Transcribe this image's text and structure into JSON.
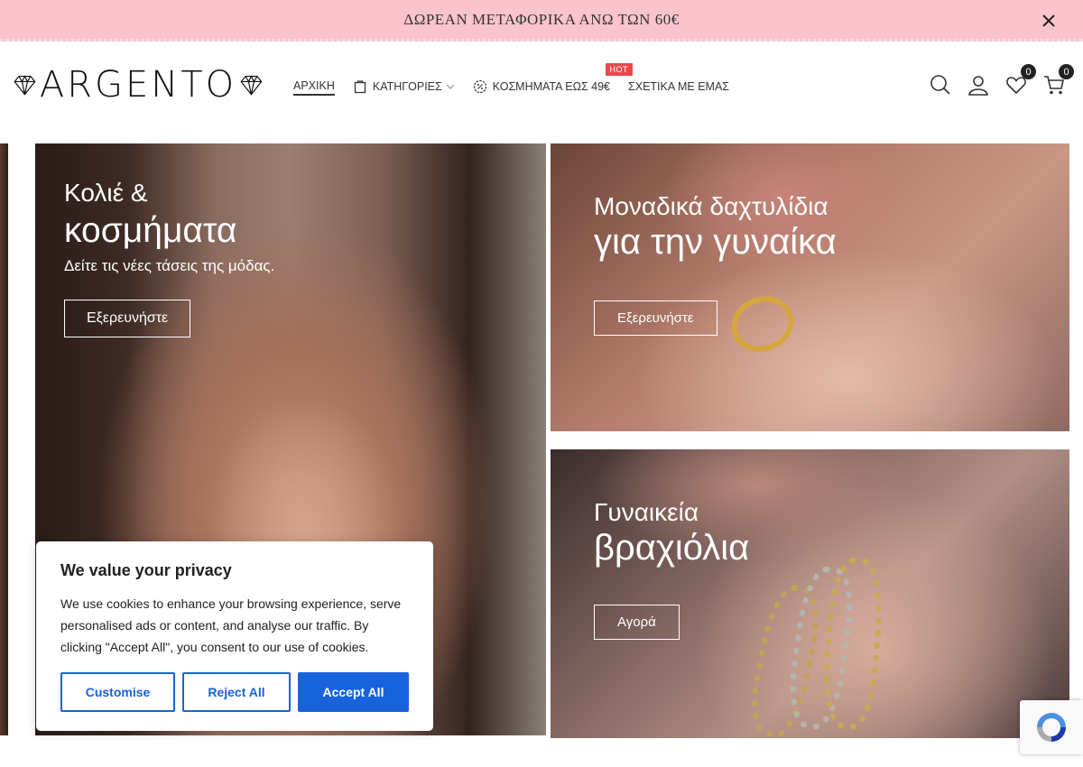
{
  "announcement": {
    "text": "ΔΩΡΕΑΝ ΜΕΤΑΦΟΡΙΚΑ ΑΝΩ ΤΩΝ 60€"
  },
  "logo": {
    "text": "ARGENTO"
  },
  "nav": {
    "items": [
      {
        "label": "ΑΡΧΙΚΗ"
      },
      {
        "label": "ΚΑΤΗΓΟΡΙΕΣ"
      },
      {
        "label": "ΚΟΣΜΗΜΑΤΑ ΕΩΣ 49€",
        "badge": "HOT"
      },
      {
        "label": "ΣΧΕΤΙΚΑ ΜΕ ΕΜΑΣ"
      }
    ]
  },
  "header": {
    "wishlist_count": "0",
    "cart_count": "0"
  },
  "banners": {
    "main": {
      "line1": "Κολιέ &",
      "line2": "κοσμήματα",
      "subtitle": "Δείτε τις νέες τάσεις της μόδας.",
      "button": "Εξερευνήστε"
    },
    "rings": {
      "line1": "Μοναδικά δαχτυλίδια",
      "line2": "για την γυναίκα",
      "button": "Εξερευνήστε"
    },
    "bracelets": {
      "line1": "Γυναικεία",
      "line2": "βραχιόλια",
      "button": "Αγορά"
    }
  },
  "cookie": {
    "title": "We value your privacy",
    "text": "We use cookies to enhance your browsing experience, serve personalised ads or content, and analyse our traffic. By clicking \"Accept All\", you consent to our use of cookies.",
    "customise": "Customise",
    "reject": "Reject All",
    "accept": "Accept All"
  },
  "colors": {
    "announcement_bg": "#fbc4cd",
    "hot_badge": "#e84a4a",
    "cookie_accent": "#1863dc"
  }
}
